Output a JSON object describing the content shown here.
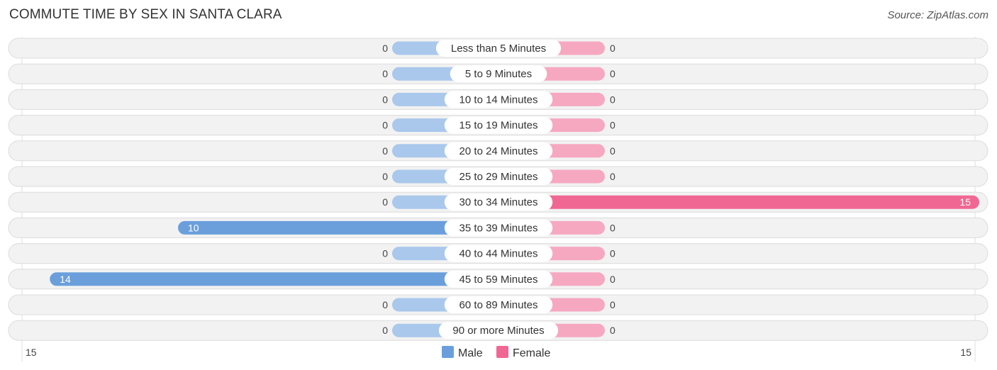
{
  "title": "COMMUTE TIME BY SEX IN SANTA CLARA",
  "source": "Source: ZipAtlas.com",
  "colors": {
    "male": "#6a9fdc",
    "male_light": "#a9c8ec",
    "female": "#f06793",
    "female_light": "#f6a8c1",
    "track": "#f2f2f2"
  },
  "chart_data": {
    "type": "bar",
    "orientation": "horizontal-diverging",
    "title": "COMMUTE TIME BY SEX IN SANTA CLARA",
    "categories": [
      "Less than 5 Minutes",
      "5 to 9 Minutes",
      "10 to 14 Minutes",
      "15 to 19 Minutes",
      "20 to 24 Minutes",
      "25 to 29 Minutes",
      "30 to 34 Minutes",
      "35 to 39 Minutes",
      "40 to 44 Minutes",
      "45 to 59 Minutes",
      "60 to 89 Minutes",
      "90 or more Minutes"
    ],
    "series": [
      {
        "name": "Male",
        "values": [
          0,
          0,
          0,
          0,
          0,
          0,
          0,
          10,
          0,
          14,
          0,
          0
        ]
      },
      {
        "name": "Female",
        "values": [
          0,
          0,
          0,
          0,
          0,
          0,
          15,
          0,
          0,
          0,
          0,
          0
        ]
      }
    ],
    "axis": {
      "left_label": "15",
      "right_label": "15",
      "max": 15
    },
    "legend": {
      "placement": "bottom-center",
      "items": [
        "Male",
        "Female"
      ]
    }
  }
}
